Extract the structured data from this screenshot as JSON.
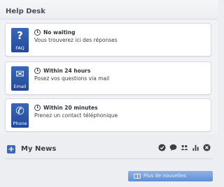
{
  "helpdesk": {
    "title": "Help Desk",
    "cards": [
      {
        "icon": "faq-icon",
        "tile_label": "FAQ",
        "glyph": "?",
        "title": "No waiting",
        "desc": "Vous trouverez ici des réponses"
      },
      {
        "icon": "email-icon",
        "tile_label": "Email",
        "glyph": "✉",
        "title": "Within 24 hours",
        "desc": "Posez vos questions via mail"
      },
      {
        "icon": "phone-icon",
        "tile_label": "Phone",
        "glyph": "✆",
        "title": "Within 20 minutes",
        "desc": "Prenez un contact téléphonique"
      }
    ]
  },
  "news": {
    "title": "My News",
    "expand_symbol": "+",
    "icons": [
      "checkmark-icon",
      "chat-bubble-icon",
      "group-icon",
      "bar-chart-icon",
      "close-icon"
    ],
    "more_button": "Plus de nouvelles"
  },
  "colors": {
    "accent": "#3b69b5",
    "background": "#eceef1"
  }
}
